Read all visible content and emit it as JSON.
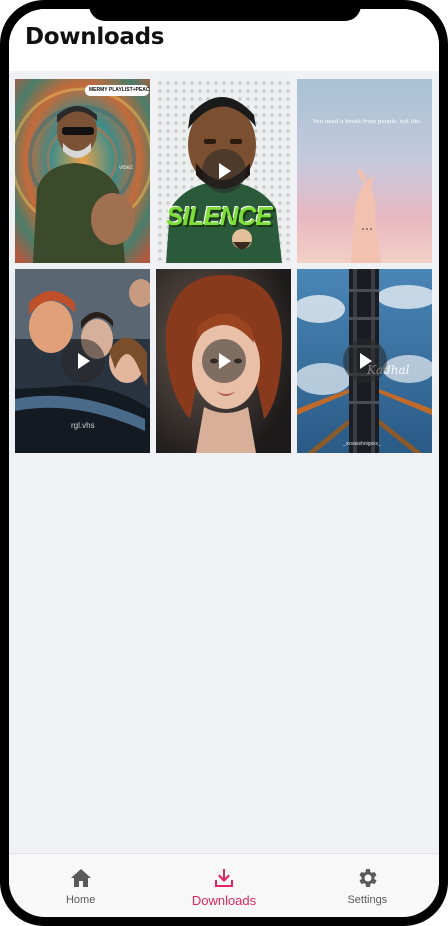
{
  "header": {
    "title": "Downloads"
  },
  "grid": {
    "items": [
      {
        "kind": "image",
        "overlay": "MERMY PLAYLIST+PEAC",
        "watermark": "vibez"
      },
      {
        "kind": "video",
        "overlay": "SILENCE"
      },
      {
        "kind": "image",
        "overlay": "You need a break from people, not life."
      },
      {
        "kind": "video",
        "overlay": "rgl.vhs"
      },
      {
        "kind": "video",
        "overlay": ""
      },
      {
        "kind": "video",
        "overlay": "Kadhal",
        "overlay_sub": "_xxvasshnigxxx_"
      }
    ]
  },
  "bottom_nav": {
    "items": [
      {
        "label": "Home",
        "icon": "home-icon",
        "active": false
      },
      {
        "label": "Downloads",
        "icon": "download-icon",
        "active": true
      },
      {
        "label": "Settings",
        "icon": "gear-icon",
        "active": false
      }
    ]
  },
  "colors": {
    "accent": "#e0245e",
    "background": "#f0f1f5",
    "nav_inactive": "#5a5a5a"
  }
}
